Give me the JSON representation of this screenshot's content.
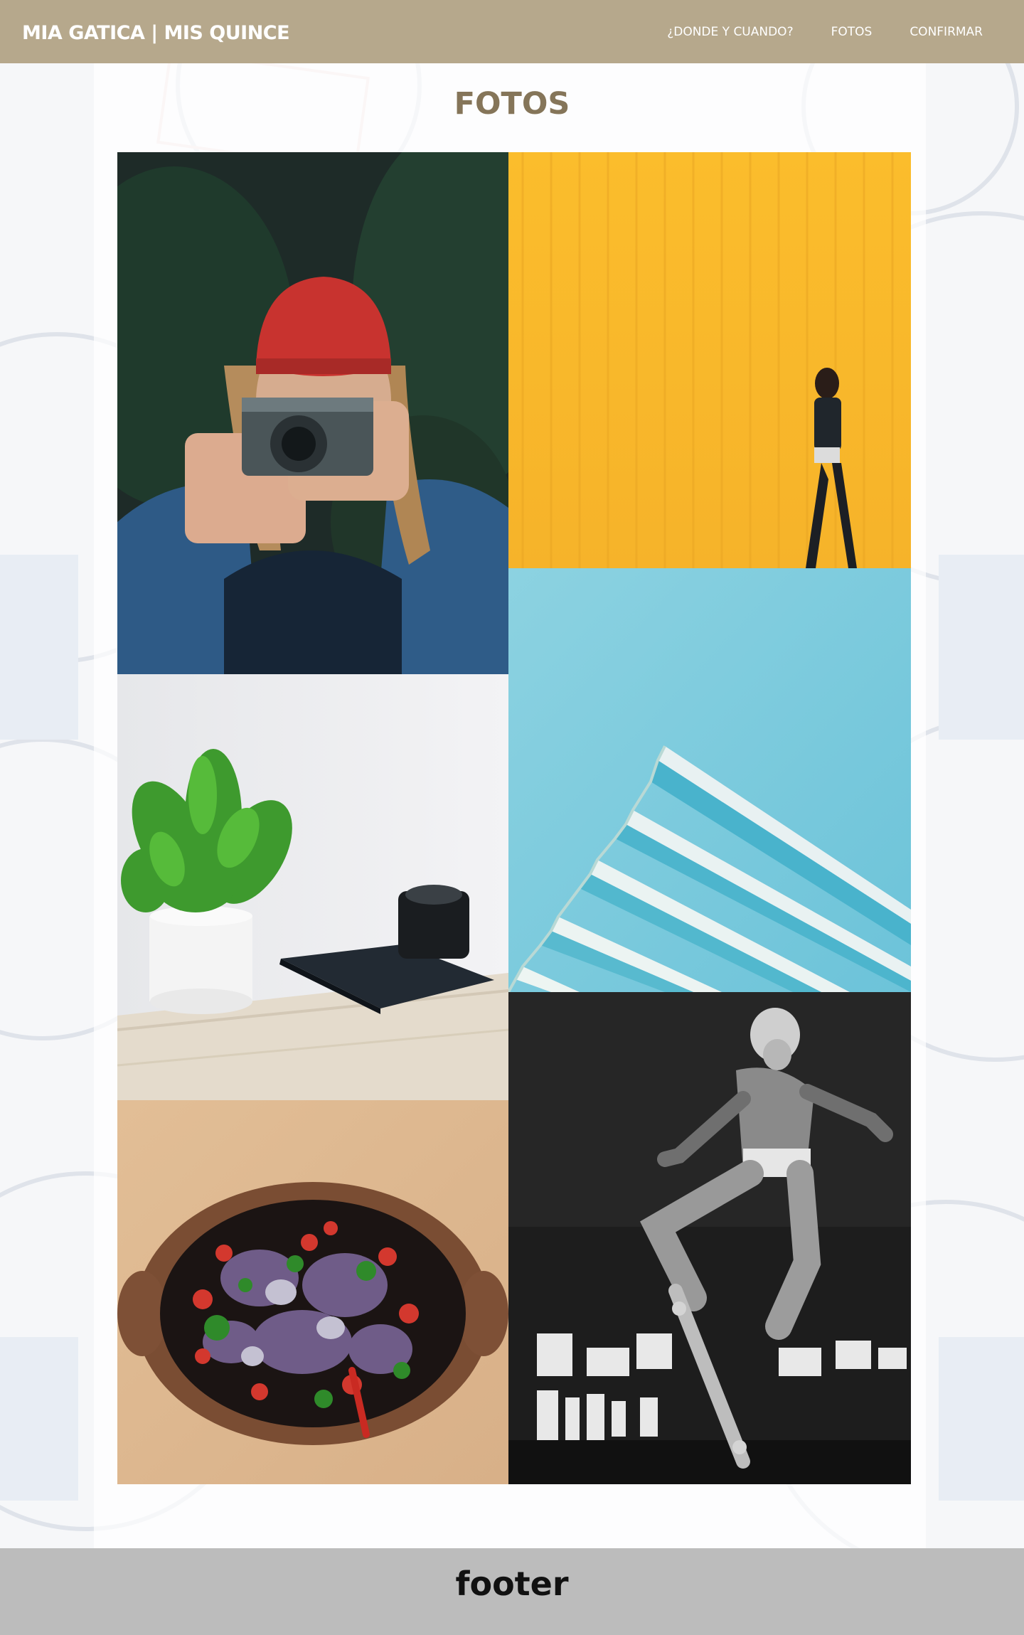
{
  "header": {
    "brand": "MIA GATICA | MIS QUINCE",
    "nav": [
      {
        "label": "¿DONDE Y CUANDO?"
      },
      {
        "label": "FOTOS"
      },
      {
        "label": "CONFIRMAR"
      }
    ],
    "background_color": "#b6a88c"
  },
  "main": {
    "title": "FOTOS",
    "title_color": "#857559",
    "photos": [
      {
        "subject": "woman-with-camera"
      },
      {
        "subject": "person-walking-yellow-wall"
      },
      {
        "subject": "modern-building-blue-sky"
      },
      {
        "subject": "plant-book-camera"
      },
      {
        "subject": "salad-bowl"
      },
      {
        "subject": "skateboarder-bw"
      }
    ]
  },
  "footer": {
    "text": "footer",
    "background_color": "#bcbcbc"
  }
}
